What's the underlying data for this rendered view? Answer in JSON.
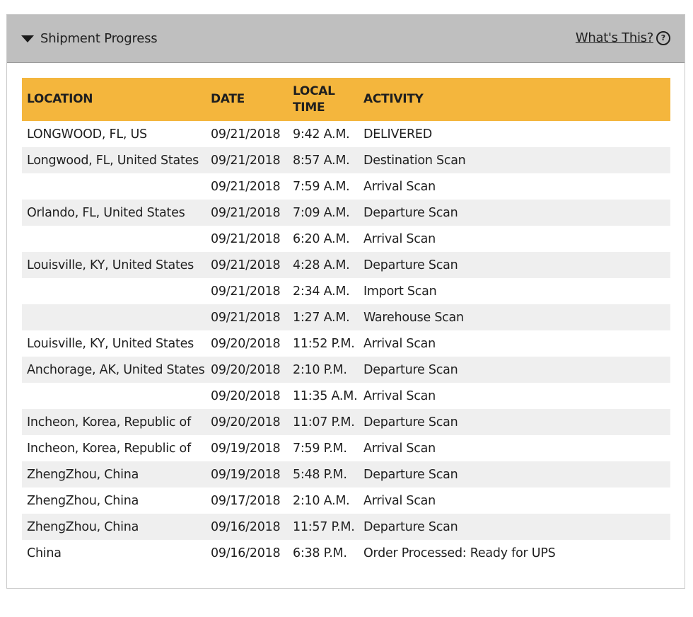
{
  "header": {
    "title": "Shipment Progress",
    "help_link": "What's This?",
    "help_icon_glyph": "?"
  },
  "table": {
    "columns": {
      "location": "LOCATION",
      "date": "DATE",
      "time_line1": "LOCAL",
      "time_line2": "TIME",
      "activity": "ACTIVITY"
    },
    "rows": [
      {
        "location": "LONGWOOD,  FL,  US",
        "date": "09/21/2018",
        "time": "9:42 A.M.",
        "activity": "DELIVERED"
      },
      {
        "location": "Longwood,  FL,  United States",
        "date": "09/21/2018",
        "time": "8:57 A.M.",
        "activity": "Destination Scan"
      },
      {
        "location": "",
        "date": "09/21/2018",
        "time": "7:59 A.M.",
        "activity": "Arrival Scan"
      },
      {
        "location": "Orlando,  FL,  United States",
        "date": "09/21/2018",
        "time": "7:09 A.M.",
        "activity": "Departure Scan"
      },
      {
        "location": "",
        "date": "09/21/2018",
        "time": "6:20 A.M.",
        "activity": "Arrival Scan"
      },
      {
        "location": "Louisville,  KY,  United States",
        "date": "09/21/2018",
        "time": "4:28 A.M.",
        "activity": "Departure Scan"
      },
      {
        "location": "",
        "date": "09/21/2018",
        "time": "2:34 A.M.",
        "activity": "Import Scan"
      },
      {
        "location": "",
        "date": "09/21/2018",
        "time": "1:27 A.M.",
        "activity": "Warehouse Scan"
      },
      {
        "location": "Louisville,  KY,  United States",
        "date": "09/20/2018",
        "time": "11:52 P.M.",
        "activity": "Arrival Scan"
      },
      {
        "location": "Anchorage,  AK,  United States",
        "date": "09/20/2018",
        "time": "2:10 P.M.",
        "activity": "Departure Scan"
      },
      {
        "location": "",
        "date": "09/20/2018",
        "time": "11:35 A.M.",
        "activity": "Arrival Scan"
      },
      {
        "location": "Incheon,  Korea, Republic of",
        "date": "09/20/2018",
        "time": "11:07 P.M.",
        "activity": "Departure Scan"
      },
      {
        "location": "Incheon,  Korea, Republic of",
        "date": "09/19/2018",
        "time": "7:59 P.M.",
        "activity": "Arrival Scan"
      },
      {
        "location": "ZhengZhou,  China",
        "date": "09/19/2018",
        "time": "5:48 P.M.",
        "activity": "Departure Scan"
      },
      {
        "location": "ZhengZhou,  China",
        "date": "09/17/2018",
        "time": "2:10 A.M.",
        "activity": "Arrival Scan"
      },
      {
        "location": "ZhengZhou,  China",
        "date": "09/16/2018",
        "time": "11:57 P.M.",
        "activity": "Departure Scan"
      },
      {
        "location": "China",
        "date": "09/16/2018",
        "time": "6:38 P.M.",
        "activity": "Order Processed: Ready for UPS"
      }
    ]
  },
  "colors": {
    "header_bg": "#bfbfbf",
    "table_header_bg": "#f4b63d",
    "stripe": "#efefef"
  }
}
